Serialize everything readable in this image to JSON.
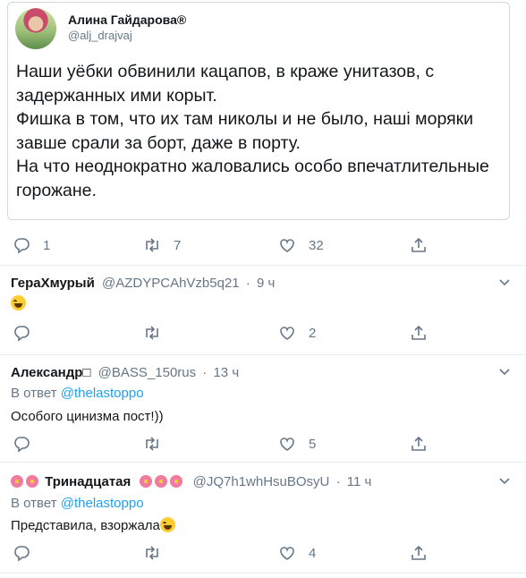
{
  "quoted_tweet": {
    "author_name": "Алина Гайдарова®",
    "author_handle": "@alj_drajvaj",
    "text": "Наши уёбки обвинили кацапов, в краже унитазов, с задержанных ими корыт.\nФишка в том, что их там николы и не было, наші моряки завше  срали за борт, даже в порту.\nНа что неоднократно жаловались особо впечатлительные горожане.",
    "replies": "1",
    "retweets": "7",
    "likes": "32"
  },
  "replies": [
    {
      "name": "ГераХмурый",
      "handle": "@AZDYPCAhVzb5q21",
      "dot": "·",
      "time": "9 ч",
      "in_reply_prefix": "",
      "in_reply_mention": "",
      "text": "",
      "emoji": "face-with-tears-of-joy",
      "likes": "2"
    },
    {
      "name": "Александр□",
      "handle": "@BASS_150rus",
      "dot": "·",
      "time": "13 ч",
      "in_reply_prefix": "В ответ ",
      "in_reply_mention": "@thelastoppo",
      "text": "Особого цинизма пост!))",
      "likes": "5"
    },
    {
      "name": "Тринадцатая",
      "handle": "@JQ7h1whHsuBOsyU",
      "dot": "·",
      "time": "11 ч",
      "in_reply_prefix": "В ответ ",
      "in_reply_mention": "@thelastoppo",
      "text": "Представила, взоржала",
      "emoji": "face-with-tears-of-joy",
      "likes": "4"
    }
  ],
  "icons": {
    "reply": "reply-icon",
    "retweet": "retweet-icon",
    "like": "heart-icon",
    "share": "share-icon",
    "more": "chevron-down-icon"
  },
  "colors": {
    "text": "#14171a",
    "secondary": "#657786",
    "link": "#1da1f2",
    "border": "#e6ecf0"
  }
}
